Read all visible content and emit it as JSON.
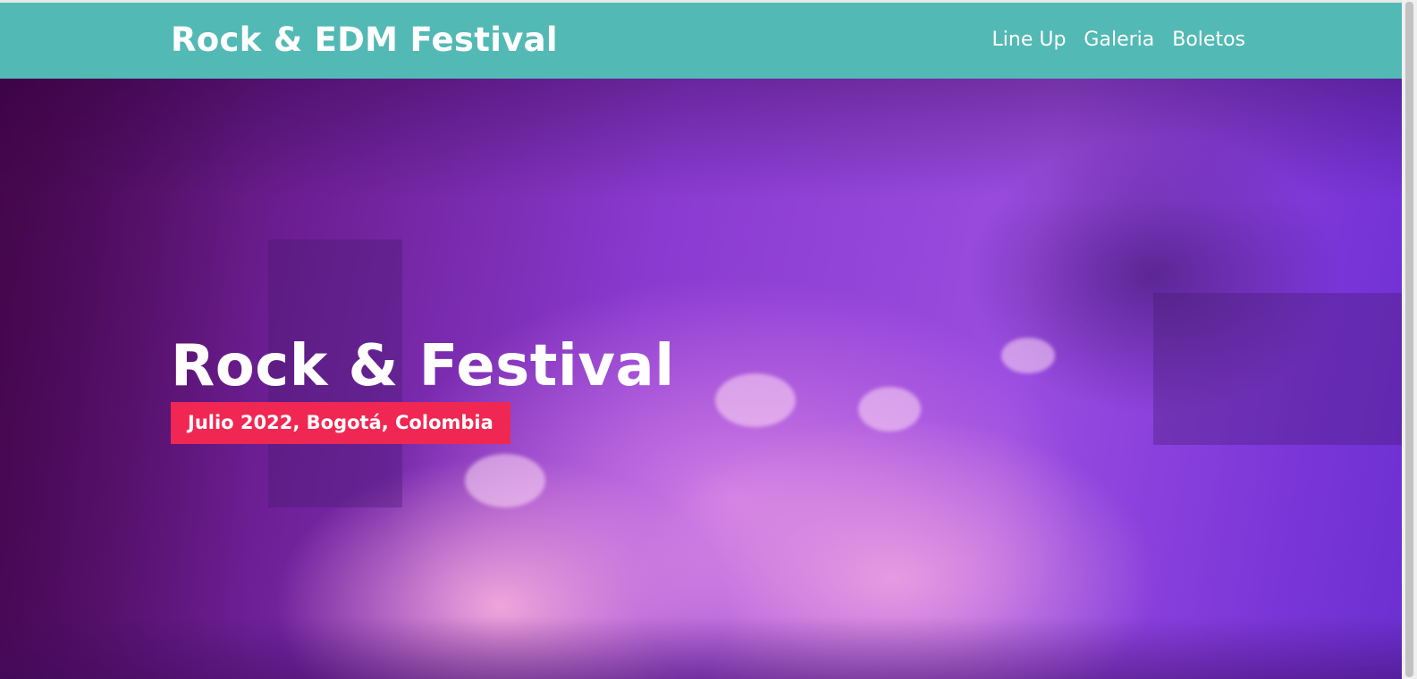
{
  "header": {
    "logo": "Rock & EDM Festival",
    "nav": [
      {
        "label": "Line Up"
      },
      {
        "label": "Galeria"
      },
      {
        "label": "Boletos"
      }
    ]
  },
  "hero": {
    "title": "Rock & Festival",
    "badge": "Julio 2022, Bogotá, Colombia"
  },
  "colors": {
    "header_bg": "#53b9b5",
    "badge_bg": "#f02752",
    "text": "#ffffff",
    "hero_overlay": "#8a3ad0"
  }
}
